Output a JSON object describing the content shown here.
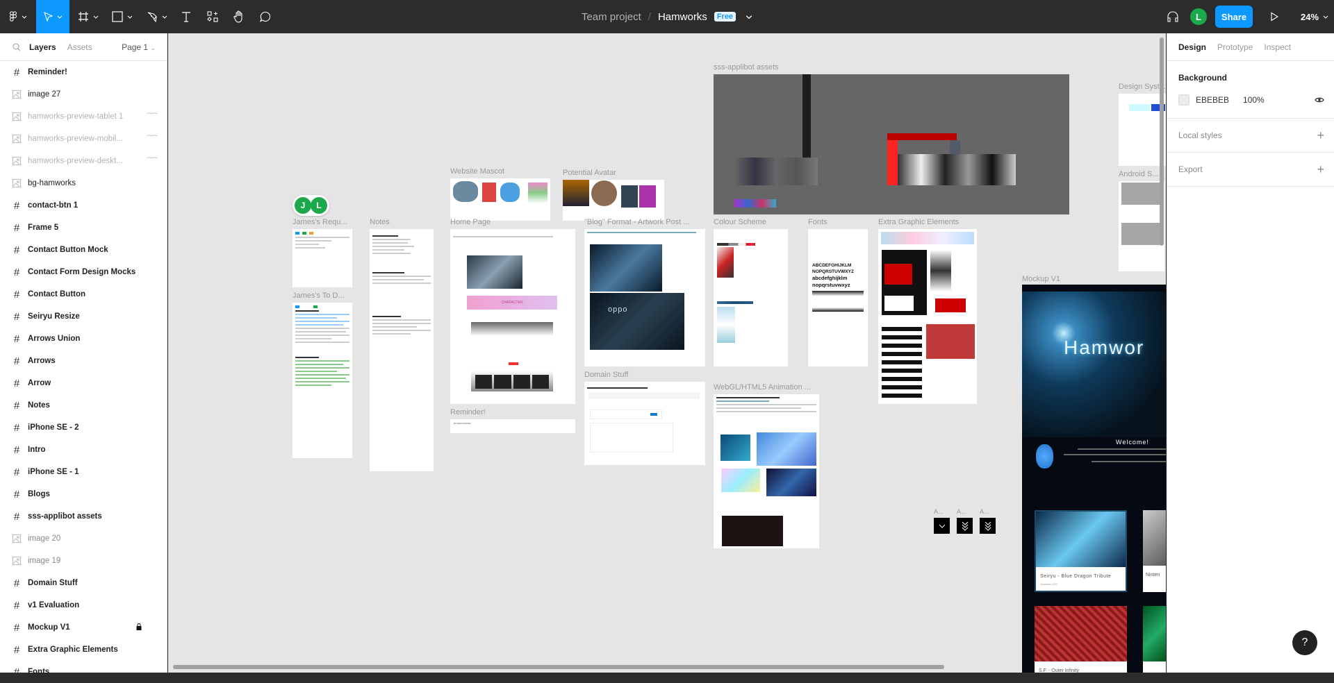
{
  "toolbar": {
    "tools": [
      {
        "name": "main-menu",
        "icon": "figma-logo-icon"
      },
      {
        "name": "move-tool",
        "icon": "move-cursor-icon",
        "active": true
      },
      {
        "name": "frame-tool",
        "icon": "frame-hash-icon"
      },
      {
        "name": "shape-tool",
        "icon": "rectangle-icon"
      },
      {
        "name": "pen-tool",
        "icon": "pen-icon"
      },
      {
        "name": "text-tool",
        "icon": "text-icon"
      },
      {
        "name": "resources-tool",
        "icon": "components-icon"
      },
      {
        "name": "hand-tool",
        "icon": "hand-icon"
      },
      {
        "name": "comment-tool",
        "icon": "comment-icon"
      }
    ],
    "team": "Team project",
    "separator": "/",
    "file_name": "Hamworks",
    "plan_badge": "Free",
    "user_initial": "L",
    "share_label": "Share",
    "zoom": "24%",
    "accent": "#0d99ff"
  },
  "left_panel": {
    "tabs": [
      "Layers",
      "Assets"
    ],
    "active_tab": "Layers",
    "page": "Page 1",
    "layers": [
      {
        "name": "Reminder!",
        "type": "frame"
      },
      {
        "name": "image 27",
        "type": "image"
      },
      {
        "name": "hamworks-preview-tablet 1",
        "type": "image",
        "hidden": true
      },
      {
        "name": "hamworks-preview-mobil...",
        "type": "image",
        "hidden": true
      },
      {
        "name": "hamworks-preview-deskt...",
        "type": "image",
        "hidden": true
      },
      {
        "name": "bg-hamworks",
        "type": "image"
      },
      {
        "name": "contact-btn 1",
        "type": "frame"
      },
      {
        "name": "Frame 5",
        "type": "frame"
      },
      {
        "name": "Contact Button Mock",
        "type": "frame"
      },
      {
        "name": "Contact Form Design Mocks",
        "type": "frame"
      },
      {
        "name": "Contact Button",
        "type": "frame"
      },
      {
        "name": "Seiryu Resize",
        "type": "frame"
      },
      {
        "name": "Arrows Union",
        "type": "frame"
      },
      {
        "name": "Arrows",
        "type": "frame"
      },
      {
        "name": "Arrow",
        "type": "frame"
      },
      {
        "name": "Notes",
        "type": "frame"
      },
      {
        "name": "iPhone SE - 2",
        "type": "frame"
      },
      {
        "name": "Intro",
        "type": "frame"
      },
      {
        "name": "iPhone SE - 1",
        "type": "frame"
      },
      {
        "name": "Blogs",
        "type": "frame"
      },
      {
        "name": "sss-applibot assets",
        "type": "frame"
      },
      {
        "name": "image 20",
        "type": "image",
        "dim": true
      },
      {
        "name": "image 19",
        "type": "image",
        "dim": true
      },
      {
        "name": "Domain Stuff",
        "type": "frame"
      },
      {
        "name": "v1 Evaluation",
        "type": "frame"
      },
      {
        "name": "Mockup V1",
        "type": "frame",
        "locked": true
      },
      {
        "name": "Extra Graphic Elements",
        "type": "frame"
      },
      {
        "name": "Fonts",
        "type": "frame"
      }
    ]
  },
  "canvas": {
    "background": "#e5e5e5",
    "cursor_avatars": [
      "J",
      "L"
    ],
    "frames": [
      {
        "label": "sss-applibot assets"
      },
      {
        "label": "Design Syste..."
      },
      {
        "label": "Android S..."
      },
      {
        "label": "Website Mascot"
      },
      {
        "label": "Potential Avatar"
      },
      {
        "label": "James's Requ..."
      },
      {
        "label": "Notes"
      },
      {
        "label": "Home Page"
      },
      {
        "label": "\"Blog\" Format - Artwork Post ..."
      },
      {
        "label": "Colour Scheme"
      },
      {
        "label": "Fonts"
      },
      {
        "label": "Extra Graphic Elements"
      },
      {
        "label": "James's To D..."
      },
      {
        "label": "Reminder!"
      },
      {
        "label": "Domain Stuff"
      },
      {
        "label": "WebGL/HTML5 Animation ..."
      },
      {
        "label": "Mockup V1"
      },
      {
        "label": "A..."
      },
      {
        "label": "A..."
      },
      {
        "label": "A..."
      }
    ],
    "reminder_text": "pruuuuunuuts",
    "fonts_sample": [
      "ABCDEFGHIJKLM",
      "NOPQRSTUVWXYZ",
      "abcdefghijklm",
      "nopqrstuvwxyz"
    ],
    "mockup": {
      "brand": "Hamwor",
      "welcome": "Welcome!",
      "card1": "Seiryu - Blue Dragon Tribute",
      "card1_date": "November 2022",
      "card2": "Ninten",
      "card3": "S.F. - Outer Infinity"
    },
    "blog_sample": "oppo",
    "character_banner": "CHARACTER"
  },
  "right_panel": {
    "tabs": [
      "Design",
      "Prototype",
      "Inspect"
    ],
    "active_tab": "Design",
    "background_title": "Background",
    "bg_hex": "EBEBEB",
    "bg_opacity": "100%",
    "local_styles": "Local styles",
    "export": "Export"
  },
  "help_label": "?"
}
